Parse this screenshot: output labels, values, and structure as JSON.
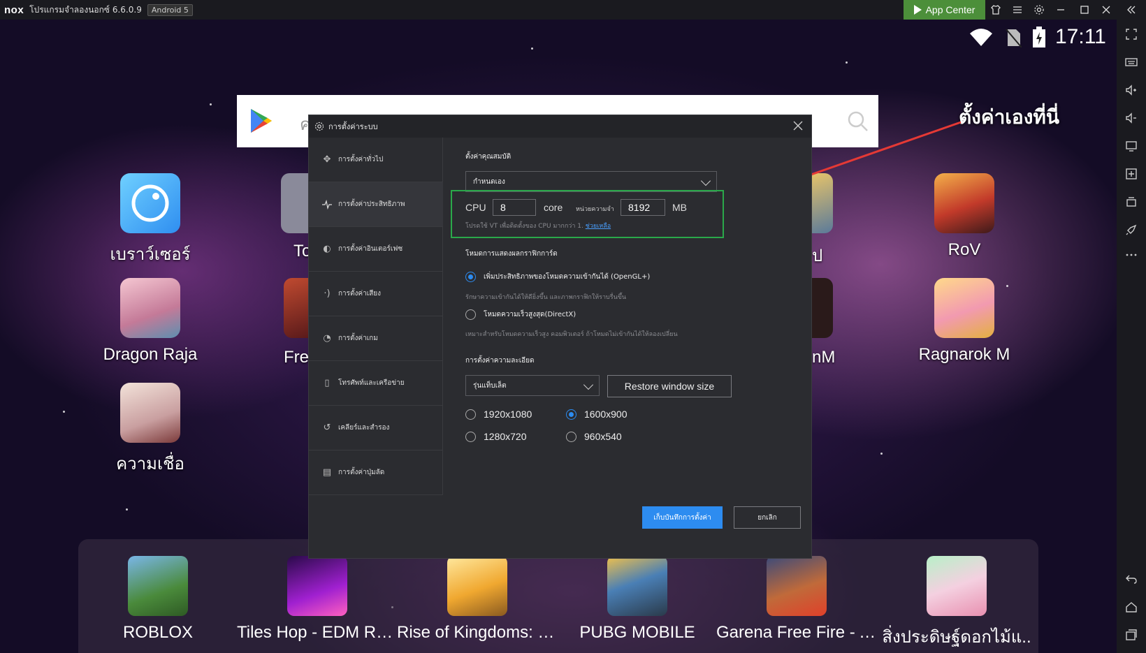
{
  "titlebar": {
    "logo": "nox",
    "app_name": "โปรแกรมจำลองนอกซ์ 6.6.0.9",
    "android_version": "Android 5",
    "app_center_label": "App Center",
    "icons": [
      "shirt-icon",
      "menu-icon",
      "gear-icon",
      "minimize-icon",
      "maximize-icon",
      "close-icon",
      "collapse-icon"
    ]
  },
  "status": {
    "time": "17:11"
  },
  "searchbar": {
    "hint": "ค"
  },
  "annotation": {
    "text": "ตั้งค่าเองที่นี่"
  },
  "desktop": {
    "apps": [
      {
        "label": "เบราว์เซอร์",
        "color": "#3aa6f2"
      },
      {
        "label": "Dragon Raja",
        "color": "#e9a4b7"
      },
      {
        "label": "ความเชื่อ",
        "color": "#d9b8b0"
      },
      {
        "label": "RoV",
        "color": "#c43b2c"
      },
      {
        "label": "Ragnarok M",
        "color": "#f1a8a8"
      }
    ],
    "partial": [
      {
        "label": "To"
      },
      {
        "label": "Free"
      },
      {
        "label": "ป"
      },
      {
        "label": "nM"
      }
    ]
  },
  "dock": {
    "apps": [
      {
        "label": "ROBLOX",
        "color": "#4a7a3b"
      },
      {
        "label": "Tiles Hop - EDM Rush!",
        "color": "#5a1a8a"
      },
      {
        "label": "Rise of Kingdoms: Lo..",
        "color": "#f0b040"
      },
      {
        "label": "PUBG MOBILE",
        "color": "#4a7fb5"
      },
      {
        "label": "Garena Free Fire - An..",
        "color": "#8a5a3a"
      },
      {
        "label": "สิ่งประดิษฐ์ดอกไม้แ..",
        "color": "#e8c0d0"
      }
    ]
  },
  "dialog": {
    "title": "การตั้งค่าระบบ",
    "nav": [
      {
        "label": "การตั้งค่าทั่วไป",
        "icon": "puzzle-icon"
      },
      {
        "label": "การตั้งค่าประสิทธิภาพ",
        "icon": "pulse-icon"
      },
      {
        "label": "การตั้งค่าอินเตอร์เฟซ",
        "icon": "palette-icon"
      },
      {
        "label": "การตั้งค่าเสียง",
        "icon": "sound-icon"
      },
      {
        "label": "การตั้งค่าเกม",
        "icon": "game-icon"
      },
      {
        "label": "โทรศัพท์และเครือข่าย",
        "icon": "phone-icon"
      },
      {
        "label": "เคลียร์และสำรอง",
        "icon": "history-icon"
      },
      {
        "label": "การตั้งค่าปุ่มลัด",
        "icon": "keyboard-icon"
      }
    ],
    "performance": {
      "section_title": "ตั้งค่าคุณสมบัติ",
      "preset_value": "กำหนดเอง",
      "cpu_label": "CPU",
      "cpu_value": "8",
      "core_label": "core",
      "memory_label": "หน่วยความจำ",
      "memory_value": "8192",
      "mb_label": "MB",
      "hint_prefix": "โปรดใช้ VT เพื่อติดตั้งของ CPU มากกว่า 1.",
      "hint_link": "ช่วยเหลือ"
    },
    "graphics": {
      "section_title": "โหมดการแสดงผลกราฟิกการ์ด",
      "opengl_label": "เพิ่มประสิทธิภาพของโหมดความเข้ากันได้ (OpenGL+)",
      "opengl_desc": "รักษาความเข้ากันได้ให้ดียิ่งขึ้น และภาพกราฟิกให้ราบรื่นขึ้น",
      "directx_label": "โหมดความเร็วสูงสุด(DirectX)",
      "directx_desc": "เหมาะสำหรับโหมดความเร็วสูง คอมพิวเตอร์ ถ้าโหมดไม่เข้ากันได้ให้ลองเปลี่ยน"
    },
    "resolution": {
      "section_title": "การตั้งค่าความละเอียด",
      "mode_value": "รุ่นแท็บเล็ต",
      "restore_label": "Restore window size",
      "options": [
        "1920x1080",
        "1600x900",
        "1280x720",
        "960x540"
      ],
      "selected": "1600x900"
    },
    "save_label": "เก็บบันทึกการตั้งค่า",
    "cancel_label": "ยกเลิก"
  }
}
